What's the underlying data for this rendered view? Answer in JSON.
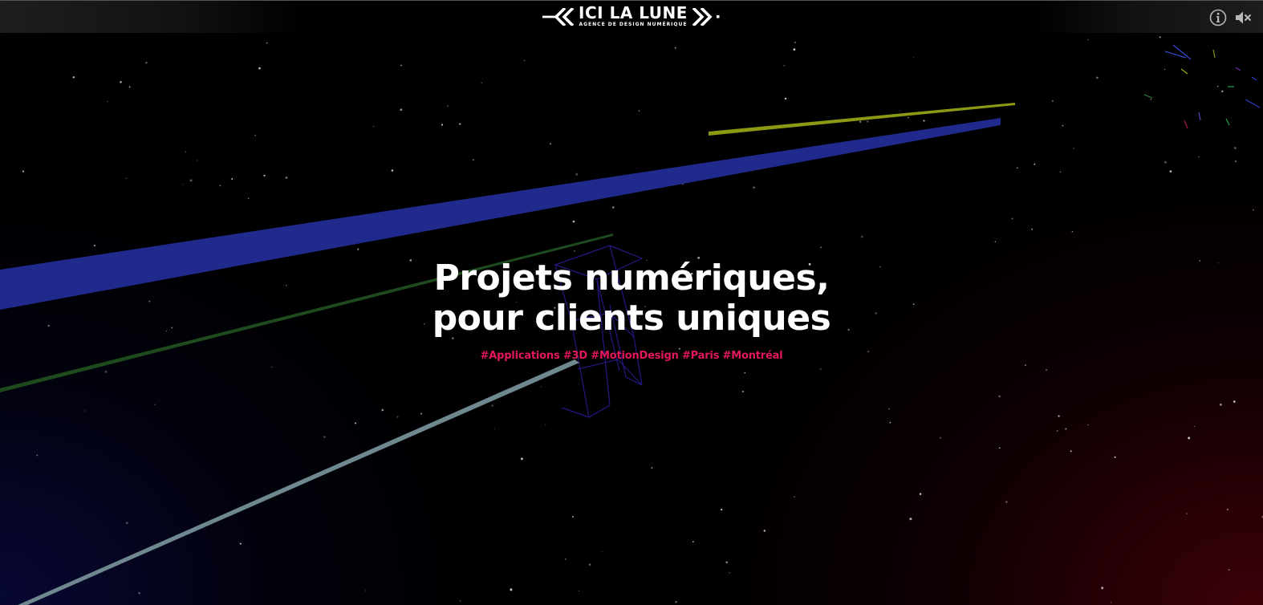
{
  "header": {
    "brand_name": "ICI LA LUNE",
    "brand_tagline": "AGENCE DE DESIGN NUMÉRIQUE",
    "brand_icon_left": "double-chevron-left",
    "brand_icon_right": "double-chevron-right",
    "info_icon": "info-circle",
    "mute_icon": "speaker-muted"
  },
  "hero": {
    "title_line1": "Projets numériques,",
    "title_line2": "pour clients uniques",
    "tags": "#Applications #3D #MotionDesign #Paris #Montréal"
  },
  "colors": {
    "background": "#000000",
    "accent_pink": "#e2185b",
    "beam_blue": "#1f2a8c",
    "beam_yellow": "#8b9a12",
    "beam_green": "#1e4a1e",
    "beam_grey": "#6f878f",
    "glow_red": "#46000a",
    "glow_navy": "#0a0a46"
  }
}
